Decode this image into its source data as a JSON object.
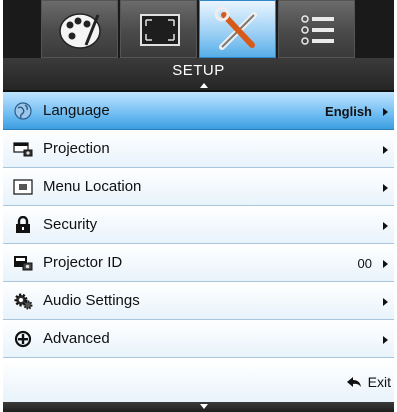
{
  "header": {
    "title": "SETUP"
  },
  "tabs": [
    {
      "icon": "palette-icon",
      "active": false
    },
    {
      "icon": "screen-resize-icon",
      "active": false
    },
    {
      "icon": "tools-icon",
      "active": true
    },
    {
      "icon": "list-icon",
      "active": false
    }
  ],
  "menu": {
    "items": [
      {
        "label": "Language",
        "value": "English",
        "icon": "globe-icon",
        "selected": true
      },
      {
        "label": "Projection",
        "value": "",
        "icon": "projector-icon",
        "selected": false
      },
      {
        "label": "Menu Location",
        "value": "",
        "icon": "menu-location-icon",
        "selected": false
      },
      {
        "label": "Security",
        "value": "",
        "icon": "lock-icon",
        "selected": false
      },
      {
        "label": "Projector ID",
        "value": "00",
        "icon": "projector-id-icon",
        "selected": false
      },
      {
        "label": "Audio Settings",
        "value": "",
        "icon": "audio-gear-icon",
        "selected": false
      },
      {
        "label": "Advanced",
        "value": "",
        "icon": "plus-circle-icon",
        "selected": false
      }
    ]
  },
  "exit": {
    "label": "Exit"
  },
  "colors": {
    "selected_row": "#6fbdf2",
    "active_tab": "#9fd1f5",
    "header_bg": "#2e2e2e"
  }
}
